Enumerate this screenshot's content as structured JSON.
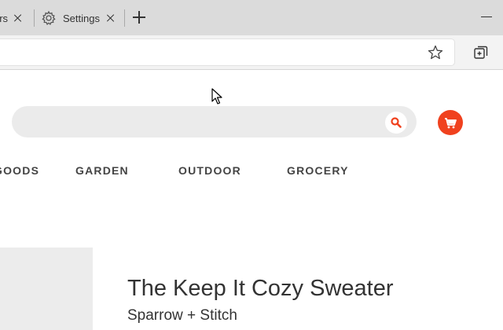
{
  "browser": {
    "tabs": [
      {
        "label": "ers"
      },
      {
        "label": "Settings"
      }
    ]
  },
  "store": {
    "search": {
      "placeholder": ""
    },
    "nav": [
      "GOODS",
      "GARDEN",
      "OUTDOOR",
      "GROCERY"
    ],
    "product": {
      "title": "The Keep It Cozy Sweater",
      "brand": "Sparrow + Stitch"
    }
  },
  "colors": {
    "accent": "#f0411e",
    "tabstrip": "#dbdbdb",
    "searchbar": "#ebebeb"
  },
  "icons": {
    "settings_tab": "gear-icon",
    "search": "search-icon",
    "cart": "cart-icon",
    "favorite": "star-icon",
    "collections": "collections-icon"
  }
}
